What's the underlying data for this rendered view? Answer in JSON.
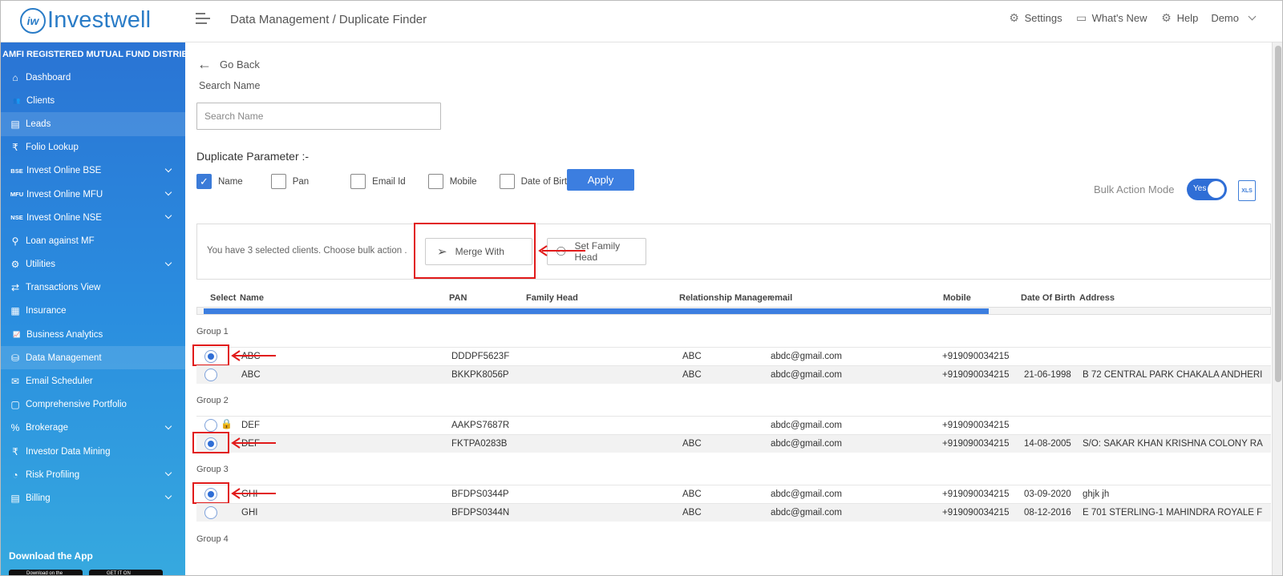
{
  "header": {
    "logo_mark": "iw",
    "brand": "Investwell",
    "title": "Data Management / Duplicate Finder",
    "nav": [
      {
        "label": "Settings",
        "icon": "gear-icon"
      },
      {
        "label": "What's New",
        "icon": "news-icon"
      },
      {
        "label": "Help",
        "icon": "help-icon"
      },
      {
        "label": "Demo",
        "icon": "chevron-down-icon"
      }
    ]
  },
  "sidebar": {
    "title": "AMFI REGISTERED MUTUAL FUND DISTRIBUTOR",
    "items": [
      {
        "label": "Dashboard",
        "icon": "home-icon",
        "glyph": "⌂",
        "chevron": false
      },
      {
        "label": "Clients",
        "icon": "users-icon",
        "glyph": "👥",
        "chevron": false
      },
      {
        "label": "Leads",
        "icon": "leads-icon",
        "glyph": "▤",
        "chevron": false
      },
      {
        "label": "Folio Lookup",
        "icon": "folio-icon",
        "glyph": "₹",
        "chevron": false
      },
      {
        "label": "Invest Online BSE",
        "icon": "bse-icon",
        "glyph": "BSE",
        "chevron": true
      },
      {
        "label": "Invest Online MFU",
        "icon": "mfu-icon",
        "glyph": "MFU",
        "chevron": true
      },
      {
        "label": "Invest Online NSE",
        "icon": "nse-icon",
        "glyph": "NSE",
        "chevron": true
      },
      {
        "label": "Loan against MF",
        "icon": "loan-icon",
        "glyph": "⚲",
        "chevron": false
      },
      {
        "label": "Utilities",
        "icon": "utilities-icon",
        "glyph": "⚙",
        "chevron": true
      },
      {
        "label": "Transactions View",
        "icon": "transactions-icon",
        "glyph": "⇄",
        "chevron": false
      },
      {
        "label": "Insurance",
        "icon": "insurance-icon",
        "glyph": "▦",
        "chevron": false
      },
      {
        "label": "Business Analytics",
        "icon": "analytics-icon",
        "glyph": "📈",
        "chevron": false
      },
      {
        "label": "Data Management",
        "icon": "data-icon",
        "glyph": "⛁",
        "chevron": false
      },
      {
        "label": "Email Scheduler",
        "icon": "email-icon",
        "glyph": "✉",
        "chevron": false
      },
      {
        "label": "Comprehensive Portfolio",
        "icon": "portfolio-icon",
        "glyph": "▢",
        "chevron": false
      },
      {
        "label": "Brokerage",
        "icon": "brokerage-icon",
        "glyph": "%",
        "chevron": true
      },
      {
        "label": "Investor Data Mining",
        "icon": "mining-icon",
        "glyph": "₹",
        "chevron": false
      },
      {
        "label": "Risk Profiling",
        "icon": "risk-icon",
        "glyph": "◔",
        "chevron": true
      },
      {
        "label": "Billing",
        "icon": "billing-icon",
        "glyph": "▤",
        "chevron": true
      }
    ],
    "download_title": "Download the App",
    "app_store": "Download on the",
    "play_store": "GET IT ON"
  },
  "main": {
    "go_back": "Go Back",
    "search_label": "Search Name",
    "search_placeholder": "Search Name",
    "search_value": "",
    "dup_label": "Duplicate Parameter :-",
    "params": [
      {
        "label": "Name",
        "checked": true
      },
      {
        "label": "Pan",
        "checked": false
      },
      {
        "label": "Email Id",
        "checked": false
      },
      {
        "label": "Mobile",
        "checked": false
      },
      {
        "label": "Date of Birth",
        "checked": false
      }
    ],
    "apply": "Apply",
    "bulk_mode_label": "Bulk Action Mode",
    "bulk_toggle": "Yes",
    "xls": "XLS",
    "bulk_message": "You have 3 selected clients. Choose bulk action .",
    "merge_with": "Merge With",
    "set_family_head": "Set Family Head"
  },
  "table": {
    "columns": [
      "Select",
      "Name",
      "PAN",
      "Family Head",
      "Relationship Manager",
      "email",
      "Mobile",
      "Date Of Birth",
      "Address"
    ],
    "groups": [
      {
        "label": "Group 1",
        "rows": [
          {
            "selected": true,
            "locked": false,
            "name": "ABC",
            "pan": "DDDPF5623F",
            "family_head": "",
            "rm": "ABC",
            "email": "abdc@gmail.com",
            "mobile": "+919090034215",
            "dob": "",
            "address": ""
          },
          {
            "selected": false,
            "locked": false,
            "name": "ABC",
            "pan": "BKKPK8056P",
            "family_head": "",
            "rm": "ABC",
            "email": "abdc@gmail.com",
            "mobile": "+919090034215",
            "dob": "21-06-1998",
            "address": "B 72 CENTRAL PARK CHAKALA ANDHERI"
          }
        ]
      },
      {
        "label": "Group 2",
        "rows": [
          {
            "selected": false,
            "locked": true,
            "name": "DEF",
            "pan": "AAKPS7687R",
            "family_head": "",
            "rm": "",
            "email": "abdc@gmail.com",
            "mobile": "+919090034215",
            "dob": "",
            "address": ""
          },
          {
            "selected": true,
            "locked": false,
            "name": "DEF",
            "pan": "FKTPA0283B",
            "family_head": "",
            "rm": "ABC",
            "email": "abdc@gmail.com",
            "mobile": "+919090034215",
            "dob": "14-08-2005",
            "address": "S/O: SAKAR KHAN KRISHNA COLONY RA"
          }
        ]
      },
      {
        "label": "Group 3",
        "rows": [
          {
            "selected": true,
            "locked": false,
            "name": "GHI",
            "pan": "BFDPS0344P",
            "family_head": "",
            "rm": "ABC",
            "email": "abdc@gmail.com",
            "mobile": "+919090034215",
            "dob": "03-09-2020",
            "address": "ghjk jh"
          },
          {
            "selected": false,
            "locked": false,
            "name": "GHI",
            "pan": "BFDPS0344N",
            "family_head": "",
            "rm": "ABC",
            "email": "abdc@gmail.com",
            "mobile": "+919090034215",
            "dob": "08-12-2016",
            "address": "E 701 STERLING-1 MAHINDRA ROYALE F"
          }
        ]
      },
      {
        "label": "Group 4",
        "rows": []
      }
    ]
  },
  "colors": {
    "brand": "#2a7cc7",
    "accent": "#3c7ee0",
    "annotation": "#e11a1a"
  }
}
